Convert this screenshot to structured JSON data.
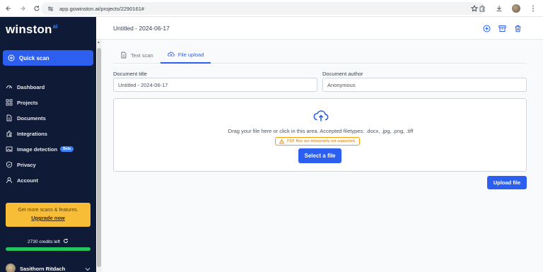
{
  "browser": {
    "url": "app.gowinston.ai/projects/2290161#"
  },
  "sidebar": {
    "logo": "winston",
    "logo_suffix": "ai",
    "quick_scan": "Quick scan",
    "items": [
      {
        "label": "Dashboard",
        "icon": "dashboard-icon"
      },
      {
        "label": "Projects",
        "icon": "projects-icon"
      },
      {
        "label": "Documents",
        "icon": "documents-icon"
      },
      {
        "label": "Integrations",
        "icon": "integrations-icon"
      },
      {
        "label": "Image detection",
        "icon": "image-icon",
        "badge": "Beta"
      },
      {
        "label": "Privacy",
        "icon": "shield-icon"
      },
      {
        "label": "Account",
        "icon": "user-icon"
      }
    ],
    "promo_text": "Get more scans & features.",
    "promo_link": "Upgrade now",
    "credits": "2730 credits left",
    "credits_fraction": 1.0,
    "user_name": "Sasithorn Ritdach"
  },
  "header": {
    "doc_name": "Untitled - 2024-06-17"
  },
  "tabs": [
    {
      "label": "Text scan",
      "active": false
    },
    {
      "label": "File upload",
      "active": true
    }
  ],
  "form": {
    "title_label": "Document title",
    "title_value": "Untitled - 2024-06-17",
    "author_label": "Document author",
    "author_value": "Anonymous"
  },
  "dropzone": {
    "instructions": "Drag your file here or click in this area. Accepted filetypes: .docx, .jpg, .png, .tiff",
    "warning": "PDF files are temporarily not supported.",
    "select_button": "Select a file"
  },
  "upload_button": "Upload file",
  "colors": {
    "sidebar_bg": "#0e1a36",
    "accent": "#2c5ef0",
    "promo": "#f7bd37",
    "credits_bar": "#22c55e",
    "warning": "#f59e0b"
  }
}
